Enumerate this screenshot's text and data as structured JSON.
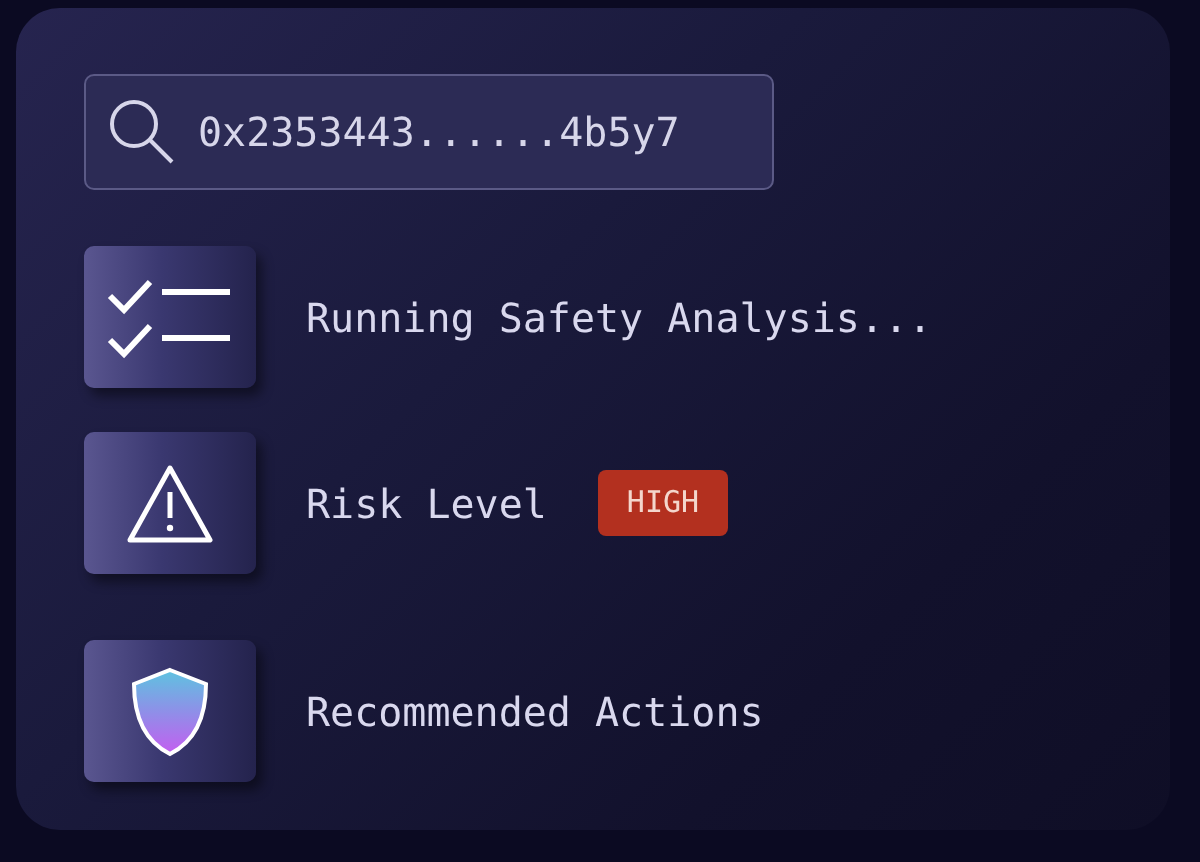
{
  "search": {
    "value": "0x2353443......4b5y7"
  },
  "steps": [
    {
      "kind": "checklist",
      "label": "Running Safety Analysis..."
    },
    {
      "kind": "warning",
      "label": "Risk Level",
      "badge": {
        "text": "HIGH",
        "color": "#b3301f"
      }
    },
    {
      "kind": "shield",
      "label": "Recommended Actions"
    }
  ]
}
